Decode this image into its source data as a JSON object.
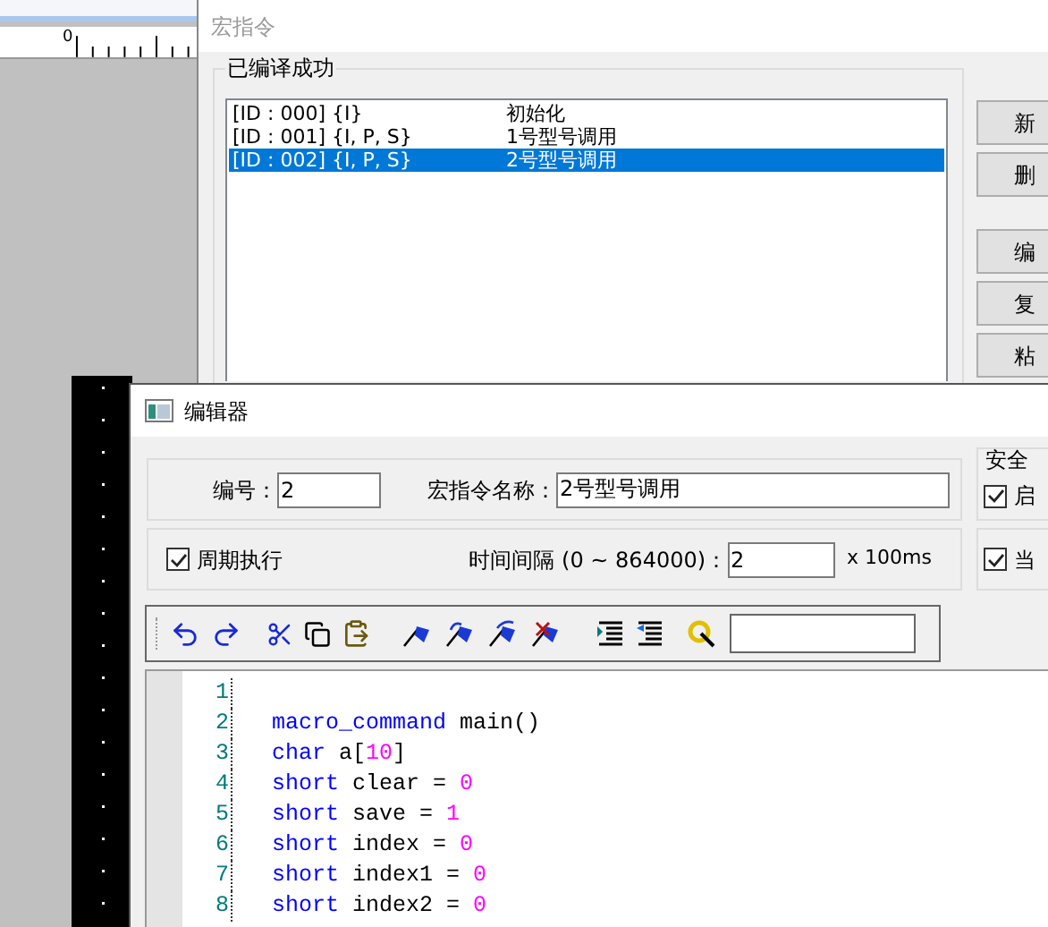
{
  "background_app": {
    "ruler_label": "0"
  },
  "macro_window": {
    "title": "宏指令",
    "group_title": "已编译成功",
    "macros": [
      {
        "id": "[ID : 000] {I}",
        "name": "初始化",
        "selected": false
      },
      {
        "id": "[ID : 001] {I, P, S}",
        "name": "1号型号调用",
        "selected": false
      },
      {
        "id": "[ID : 002] {I, P, S}",
        "name": "2号型号调用",
        "selected": true
      }
    ],
    "buttons": [
      "新",
      "删",
      "编",
      "复",
      "粘"
    ]
  },
  "editor_window": {
    "title": "编辑器",
    "number_label": "编号：",
    "number_value": "2",
    "name_label": "宏指令名称：",
    "name_value": "2号型号调用",
    "security": {
      "title": "安全",
      "label": "启",
      "checked": true
    },
    "periodic": {
      "label": "周期执行",
      "checked": true
    },
    "interval_label": "时间间隔 (0 ~ 864000)：",
    "interval_value": "2",
    "interval_unit": "x 100ms",
    "right_option": {
      "label": "当",
      "checked": true
    },
    "code_lines": [
      {
        "number": "1"
      },
      {
        "number": "2",
        "tokens": [
          {
            "kind": "keyword",
            "text": "macro_command"
          },
          {
            "kind": "plain",
            "text": " main()"
          }
        ]
      },
      {
        "number": "3",
        "tokens": [
          {
            "kind": "keyword",
            "text": "char"
          },
          {
            "kind": "plain",
            "text": " a["
          },
          {
            "kind": "number",
            "text": "10"
          },
          {
            "kind": "plain",
            "text": "]"
          }
        ]
      },
      {
        "number": "4",
        "tokens": [
          {
            "kind": "keyword",
            "text": "short"
          },
          {
            "kind": "plain",
            "text": " clear = "
          },
          {
            "kind": "number",
            "text": "0"
          }
        ]
      },
      {
        "number": "5",
        "tokens": [
          {
            "kind": "keyword",
            "text": "short"
          },
          {
            "kind": "plain",
            "text": " save = "
          },
          {
            "kind": "number",
            "text": "1"
          }
        ]
      },
      {
        "number": "6",
        "tokens": [
          {
            "kind": "keyword",
            "text": "short"
          },
          {
            "kind": "plain",
            "text": " index = "
          },
          {
            "kind": "number",
            "text": "0"
          }
        ]
      },
      {
        "number": "7",
        "tokens": [
          {
            "kind": "keyword",
            "text": "short"
          },
          {
            "kind": "plain",
            "text": " index1 = "
          },
          {
            "kind": "number",
            "text": "0"
          }
        ]
      },
      {
        "number": "8",
        "tokens": [
          {
            "kind": "keyword",
            "text": "short"
          },
          {
            "kind": "plain",
            "text": " index2 = "
          },
          {
            "kind": "number",
            "text": "0"
          }
        ]
      }
    ]
  }
}
